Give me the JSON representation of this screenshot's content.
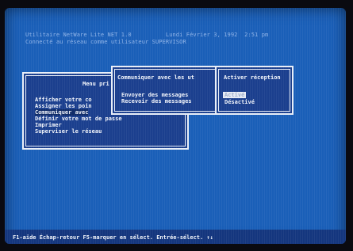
{
  "header": {
    "line1": "Utilitaire NetWare Lite NET 1.0          Lundi Février 3, 1992  2:51 pm",
    "line2": "Connecté au réseau comme utilisateur SUPERVISOR"
  },
  "main_menu": {
    "title": "Menu pri",
    "items": [
      "Afficher votre co",
      "Assigner les poin",
      "Communiquer avec",
      "Définir votre mot de passe",
      "Imprimer",
      "Superviser le réseau"
    ]
  },
  "communicate_menu": {
    "title": "Communiquer avec les ut",
    "items": [
      "Envoyer des messages",
      "Recevoir des messages"
    ]
  },
  "reception_menu": {
    "title": "Activer réception",
    "items": [
      "Activé",
      "Désactivé"
    ]
  },
  "status_bar": {
    "text": "F1-aide Échap-retour F5-marquer en sélect. Entrée-sélect. ↑↓"
  }
}
